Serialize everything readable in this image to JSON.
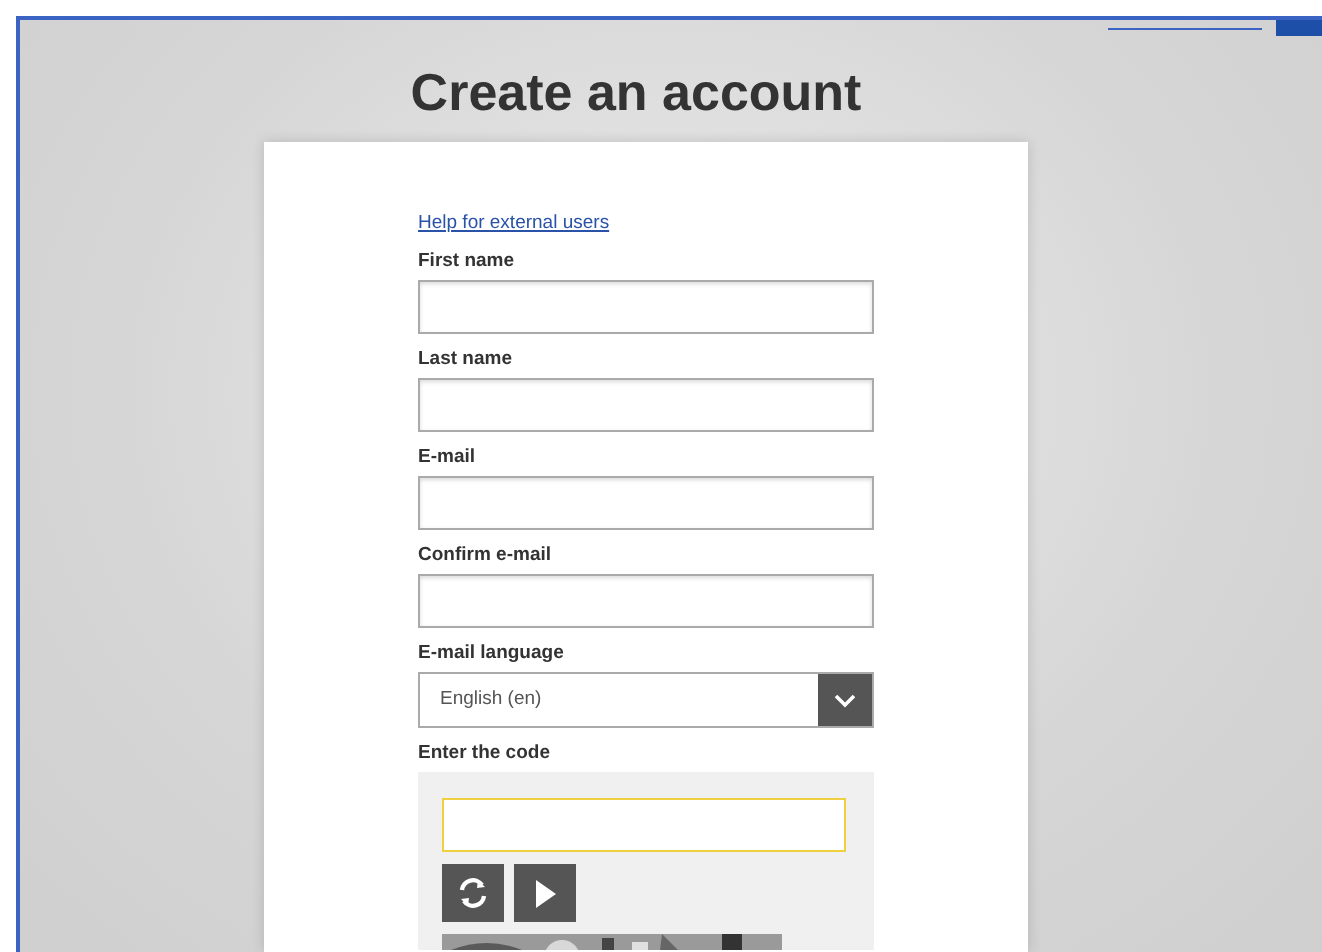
{
  "title": "Create an account",
  "help_link": "Help for external users",
  "fields": [
    {
      "kind": "text",
      "label": "First name"
    },
    {
      "kind": "text",
      "label": "Last name"
    },
    {
      "kind": "text",
      "label": "E-mail"
    },
    {
      "kind": "text",
      "label": "Confirm e-mail"
    },
    {
      "kind": "select",
      "label": "E-mail language",
      "value": "English (en)"
    },
    {
      "kind": "captcha",
      "label": "Enter the code"
    }
  ]
}
